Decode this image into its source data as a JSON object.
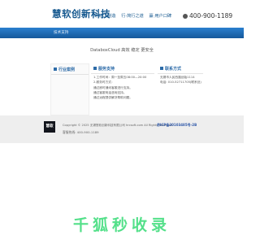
{
  "header": {
    "logo": "慧软创新科技",
    "slogans": [
      "专·精工制造",
      "行·简行之道",
      "赢·用户口碑"
    ],
    "phone": "400-900-1189"
  },
  "nav": {
    "items": [
      "技术支持"
    ]
  },
  "main": {
    "title": "DataboxCloud 高效 稳定 更安全",
    "left": {
      "heading": "行业案例"
    },
    "middle": {
      "heading": "服务支持",
      "lines": [
        "1.工作时间：周一至周五08:00—20:00",
        "2.服务时方式：",
        "通过即时通讯客服进行支持。",
        "通过客服电话咨询支持。",
        "通过远程提供解决帮助问题。"
      ]
    },
    "right": {
      "heading": "联系方式",
      "lines": [
        "无锡市人民西路创始1114",
        "电话: 010-52711705(联系处)"
      ]
    }
  },
  "footer": {
    "logo_text": "慧软",
    "copyright": "Copyright © 2025 无锡慧软创新科技有限公司 hrcsoft.com All Rights Reserved.",
    "icp": "苏ICP备20103485号-2B",
    "phone": "客服热线: 400-900-1189"
  },
  "watermark": "千狐秒收录",
  "colors": {
    "brand": "#15588f",
    "nav": "#1f6fbb",
    "watermark": "#54e08a"
  }
}
